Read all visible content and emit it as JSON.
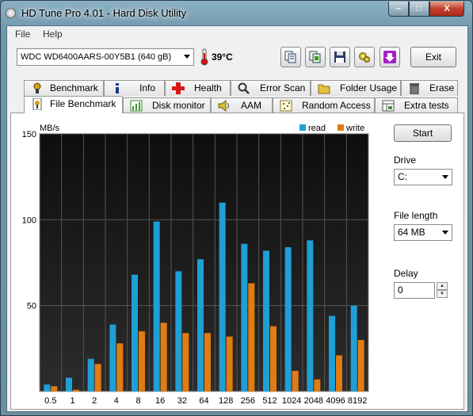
{
  "window": {
    "title": "HD Tune Pro 4.01 - Hard Disk Utility",
    "min_label": "–",
    "max_label": "□",
    "close_label": "X"
  },
  "menu": {
    "file": "File",
    "help": "Help"
  },
  "toolbar": {
    "drive": "WDC WD6400AARS-00Y5B1 (640 gB)",
    "temperature": "39°C",
    "exit_label": "Exit"
  },
  "tabs_row1": [
    {
      "label": "Benchmark",
      "icon": "benchmark-icon"
    },
    {
      "label": "Info",
      "icon": "info-icon"
    },
    {
      "label": "Health",
      "icon": "health-cross-icon"
    },
    {
      "label": "Error Scan",
      "icon": "error-scan-icon"
    },
    {
      "label": "Folder Usage",
      "icon": "folder-icon"
    },
    {
      "label": "Erase",
      "icon": "trash-icon"
    }
  ],
  "tabs_row2": [
    {
      "label": "File Benchmark",
      "icon": "file-benchmark-icon",
      "active": true
    },
    {
      "label": "Disk monitor",
      "icon": "disk-monitor-icon"
    },
    {
      "label": "AAM",
      "icon": "speaker-icon"
    },
    {
      "label": "Random Access",
      "icon": "random-access-icon"
    },
    {
      "label": "Extra tests",
      "icon": "extra-tests-icon"
    }
  ],
  "side": {
    "start_label": "Start",
    "drive_label": "Drive",
    "drive_value": "C:",
    "file_length_label": "File length",
    "file_length_value": "64 MB",
    "delay_label": "Delay",
    "delay_value": "0"
  },
  "chart_data": {
    "type": "bar",
    "ylabel": "MB/s",
    "ylim": [
      0,
      150
    ],
    "yticks": [
      50,
      100,
      150
    ],
    "categories": [
      "0.5",
      "1",
      "2",
      "4",
      "8",
      "16",
      "32",
      "64",
      "128",
      "256",
      "512",
      "1024",
      "2048",
      "4096",
      "8192"
    ],
    "series": [
      {
        "name": "read",
        "color": "#1e9fd6",
        "values": [
          4,
          8,
          19,
          39,
          68,
          99,
          70,
          77,
          110,
          86,
          82,
          84,
          88,
          44,
          50
        ]
      },
      {
        "name": "write",
        "color": "#e07c12",
        "values": [
          3,
          1,
          16,
          28,
          35,
          40,
          34,
          34,
          32,
          63,
          38,
          12,
          7,
          21,
          30
        ]
      }
    ],
    "grid": true,
    "legend": "top-right",
    "background": "#1c1c1c"
  }
}
